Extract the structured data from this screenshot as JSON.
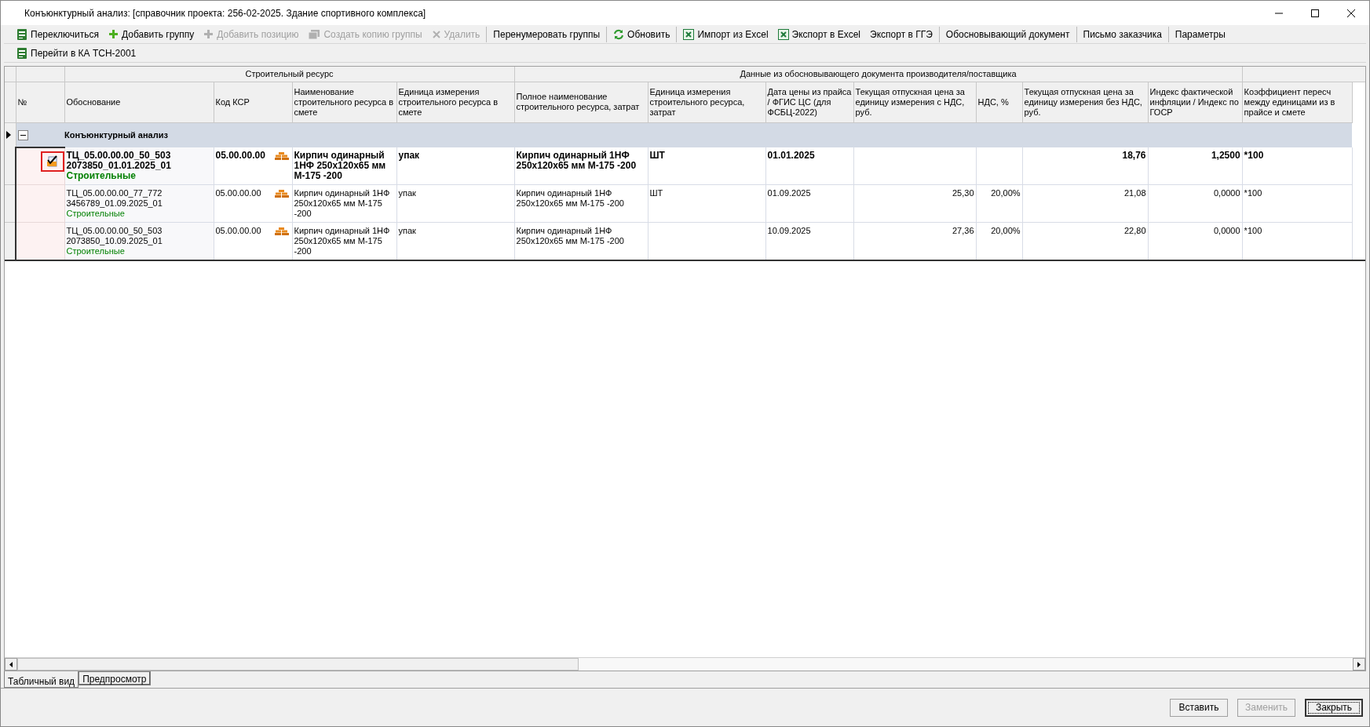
{
  "window": {
    "title": "Конъюнктурный анализ: [справочник проекта: 256-02-2025. Здание спортивного комплекса]"
  },
  "toolbar_rows": [
    [
      [
        {
          "label": "Переключиться",
          "kind": "ka",
          "disabled": false
        },
        {
          "label": "Добавить группу",
          "kind": "plus",
          "disabled": false
        },
        {
          "label": "Добавить позицию",
          "kind": "plus",
          "disabled": true
        },
        {
          "label": "Создать копию группы",
          "kind": "copy",
          "disabled": true
        },
        {
          "label": "Удалить",
          "kind": "delete",
          "disabled": true
        }
      ],
      [
        {
          "label": "Перенумеровать группы",
          "disabled": false
        }
      ],
      [
        {
          "label": "Обновить",
          "kind": "refresh",
          "disabled": false
        }
      ],
      [
        {
          "label": "Импорт из Excel",
          "kind": "excel",
          "disabled": false
        },
        {
          "label": "Экспорт в Excel",
          "kind": "excel",
          "disabled": false
        },
        {
          "label": "Экспорт в ГГЭ",
          "disabled": false
        }
      ],
      [
        {
          "label": "Обосновывающий документ",
          "disabled": false
        }
      ],
      [
        {
          "label": "Письмо заказчика",
          "disabled": false
        }
      ],
      [
        {
          "label": "Параметры",
          "disabled": false
        }
      ]
    ],
    [
      [
        {
          "label": "Перейти в КА ТСН-2001",
          "kind": "ka",
          "disabled": false
        }
      ]
    ]
  ],
  "table": {
    "column_groups": [
      {
        "label": "Строительный ресурс"
      },
      {
        "label": "Данные из обосновывающего документа производителя/поставщика"
      }
    ],
    "columns": [
      "№",
      "Обоснование",
      "Код КСР",
      "Наименование строительного ресурса в смете",
      "Единица измерения строительного ресурса в смете",
      "Полное наименование строительного ресурса, затрат",
      "Единица измерения строительного ресурса, затрат",
      "Дата цены из прайса / ФГИС ЦС (для ФСБЦ-2022)",
      "Текущая отпускная цена за единицу измерения с НДС, руб.",
      "НДС, %",
      "Текущая отпускная цена за единицу измерения без НДС, руб.",
      "Индекс фактической инфляции /  Индекс по  ГОСР",
      "Коэффициент пересч между единицами из в прайсе и смете"
    ],
    "group_row": {
      "label": "Конъюнктурный анализ",
      "expanded": true,
      "current": true
    },
    "rows": [
      {
        "selected": true,
        "marked": true,
        "basis": "ТЦ_05.00.00.00_50_503 2073850_01.01.2025_01",
        "category": "Строительные",
        "ksr": "05.00.00.00",
        "name": "Кирпич одинарный 1НФ 250x120x65 мм М-175 -200",
        "unit": "упак",
        "full_name": "Кирпич одинарный 1НФ 250x120x65 мм М-175 -200",
        "unit2": "ШТ",
        "date": "01.01.2025",
        "price_vat": "",
        "vat": "",
        "price": "18,76",
        "index": "1,2500",
        "coef": "*100"
      },
      {
        "selected": false,
        "marked": false,
        "basis": "ТЦ_05.00.00.00_77_772 3456789_01.09.2025_01",
        "category": "Строительные",
        "ksr": "05.00.00.00",
        "name": "Кирпич одинарный 1НФ 250x120x65 мм М-175 -200",
        "unit": "упак",
        "full_name": "Кирпич одинарный 1НФ 250x120x65 мм М-175 -200",
        "unit2": "ШТ",
        "date": "01.09.2025",
        "price_vat": "25,30",
        "vat": "20,00%",
        "price": "21,08",
        "index": "0,0000",
        "coef": "*100"
      },
      {
        "selected": false,
        "marked": false,
        "basis": "ТЦ_05.00.00.00_50_503 2073850_10.09.2025_01",
        "category": "Строительные",
        "ksr": "05.00.00.00",
        "name": "Кирпич одинарный 1НФ 250x120x65 мм М-175 -200",
        "unit": "упак",
        "full_name": "Кирпич одинарный 1НФ 250x120x65 мм М-175 -200",
        "unit2": "",
        "date": "10.09.2025",
        "price_vat": "27,36",
        "vat": "20,00%",
        "price": "22,80",
        "index": "0,0000",
        "coef": "*100"
      }
    ]
  },
  "tabs": [
    {
      "label": "Табличный вид",
      "selected": true
    },
    {
      "label": "Предпросмотр",
      "selected": false
    }
  ],
  "buttons": [
    {
      "label": "Вставить",
      "disabled": false,
      "default": false
    },
    {
      "label": "Заменить",
      "disabled": true,
      "default": false
    },
    {
      "label": "Закрыть",
      "disabled": false,
      "default": true
    }
  ]
}
